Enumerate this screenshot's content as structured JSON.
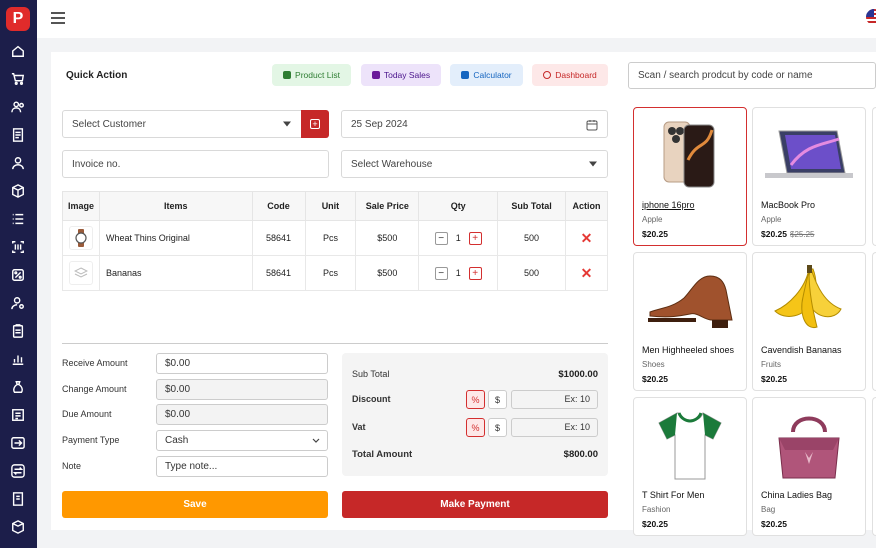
{
  "quick_action": {
    "title": "Quick Action",
    "buttons": [
      {
        "label": "Product List",
        "icon": "cart-icon",
        "bg": "#e3f6e5",
        "color": "#2e7d32"
      },
      {
        "label": "Today Sales",
        "icon": "receipt-icon",
        "bg": "#ede3fa",
        "color": "#6a1b9a"
      },
      {
        "label": "Calculator",
        "icon": "calculator-icon",
        "bg": "#e3eefb",
        "color": "#1565c0"
      },
      {
        "label": "Dashboard",
        "icon": "power-icon",
        "bg": "#fde8e8",
        "color": "#c62828"
      }
    ]
  },
  "form": {
    "customer_placeholder": "Select Customer",
    "date_value": "25 Sep 2024",
    "invoice_placeholder": "Invoice no.",
    "warehouse_placeholder": "Select Warehouse"
  },
  "table": {
    "headers": [
      "Image",
      "Items",
      "Code",
      "Unit",
      "Sale Price",
      "Qty",
      "Sub Total",
      "Action"
    ],
    "rows": [
      {
        "item": "Wheat Thins Original",
        "code": "58641",
        "unit": "Pcs",
        "price": "$500",
        "qty": "1",
        "subtotal": "500"
      },
      {
        "item": "Bananas",
        "code": "58641",
        "unit": "Pcs",
        "price": "$500",
        "qty": "1",
        "subtotal": "500"
      }
    ]
  },
  "payment": {
    "receive_label": "Receive Amount",
    "receive_value": "$0.00",
    "change_label": "Change Amount",
    "change_value": "$0.00",
    "due_label": "Due Amount",
    "due_value": "$0.00",
    "type_label": "Payment Type",
    "type_value": "Cash",
    "note_label": "Note",
    "note_placeholder": "Type note..."
  },
  "summary": {
    "subtotal_label": "Sub Total",
    "subtotal_value": "$1000.00",
    "discount_label": "Discount",
    "discount_placeholder": "Ex: 10",
    "vat_label": "Vat",
    "vat_placeholder": "Ex: 10",
    "total_label": "Total Amount",
    "total_value": "$800.00",
    "percent_symbol": "%",
    "dollar_symbol": "$"
  },
  "actions": {
    "save_label": "Save",
    "pay_label": "Make Payment"
  },
  "search": {
    "placeholder": "Scan / search prodcut by code or name"
  },
  "products": [
    {
      "name": "iphone 16pro",
      "category": "Apple",
      "price": "$20.25",
      "old_price": "",
      "icon": "phone-image"
    },
    {
      "name": "MacBook Pro",
      "category": "Apple",
      "price": "$20.25",
      "old_price": "$25.25",
      "icon": "laptop-image"
    },
    {
      "name": "Men Highheeled shoes",
      "category": "Shoes",
      "price": "$20.25",
      "old_price": "",
      "icon": "shoe-image"
    },
    {
      "name": "Cavendish Bananas",
      "category": "Fruits",
      "price": "$20.25",
      "old_price": "",
      "icon": "banana-image"
    },
    {
      "name": "T Shirt For Men",
      "category": "Fashion",
      "price": "$20.25",
      "old_price": "",
      "icon": "tshirt-image"
    },
    {
      "name": "China Ladies Bag",
      "category": "Bag",
      "price": "$20.25",
      "old_price": "",
      "icon": "bag-image"
    }
  ],
  "colors": {
    "brand": "#c62828",
    "sidebar": "#1c1e4a",
    "save": "#ff9800"
  }
}
